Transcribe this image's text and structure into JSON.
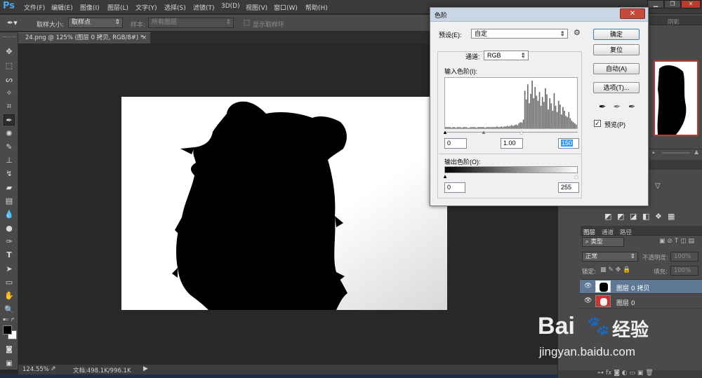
{
  "app": {
    "logo": "Ps"
  },
  "menu": [
    "文件(F)",
    "编辑(E)",
    "图像(I)",
    "图层(L)",
    "文字(Y)",
    "选择(S)",
    "滤镜(T)",
    "3D(D)",
    "视图(V)",
    "窗口(W)",
    "帮助(H)"
  ],
  "options": {
    "sample_size_label": "取样大小:",
    "sample_size_value": "取样点",
    "sample_label": "样本:",
    "sample_value": "所有图层",
    "show_ring_label": "显示取样环"
  },
  "document": {
    "tab_title": "24.png @ 125% (图层 0 拷贝, RGB/8#) *",
    "tab_close": "×"
  },
  "status": {
    "zoom": "124.55%",
    "doc_info": "文档:498.1K/996.1K"
  },
  "levels": {
    "title": "色阶",
    "preset_label": "预设(E):",
    "preset_value": "自定",
    "channel_label": "通道:",
    "channel_value": "RGB",
    "input_label": "输入色阶(I):",
    "input_black": "0",
    "input_gamma": "1.00",
    "input_white": "150",
    "output_label": "输出色阶(O):",
    "output_black": "0",
    "output_white": "255",
    "buttons": {
      "ok": "确定",
      "reset": "复位",
      "auto": "自动(A)",
      "options": "选项(T)..."
    },
    "preview_label": "预览(P)",
    "preview_checked": true,
    "histogram": [
      2,
      2,
      2,
      2,
      1,
      2,
      2,
      1,
      2,
      2,
      2,
      1,
      2,
      2,
      2,
      1,
      1,
      2,
      2,
      2,
      2,
      1,
      2,
      2,
      2,
      2,
      2,
      1,
      2,
      2,
      2,
      2,
      2,
      2,
      2,
      3,
      2,
      2,
      3,
      2,
      3,
      3,
      4,
      3,
      4,
      5,
      4,
      5,
      6,
      5,
      8,
      10,
      9,
      14,
      60,
      46,
      70,
      40,
      55,
      76,
      48,
      66,
      52,
      44,
      58,
      36,
      50,
      42,
      64,
      54,
      30,
      48,
      40,
      28,
      56,
      36,
      26,
      44,
      38,
      22,
      34,
      28,
      20,
      18,
      26,
      16,
      12,
      10,
      8,
      6
    ]
  },
  "right_top": {
    "tab": "阴影"
  },
  "layers_panel": {
    "tabs": [
      "图层",
      "通道",
      "路径"
    ],
    "filter_kind": "类型",
    "blend_mode": "正常",
    "opacity_label": "不透明度:",
    "opacity_value": "100%",
    "lock_label": "锁定:",
    "fill_label": "填充:",
    "fill_value": "100%",
    "layers": [
      {
        "name": "图层 0 拷贝",
        "selected": true
      },
      {
        "name": "图层 0",
        "selected": false
      }
    ]
  },
  "watermark": {
    "brand": "Bai",
    "brand_suffix": "经验",
    "url": "jingyan.baidu.com"
  },
  "colors": {
    "accent_blue": "#49a6e9",
    "layer_selected": "#5e7896",
    "dialog_title": "#c9d6e6"
  }
}
